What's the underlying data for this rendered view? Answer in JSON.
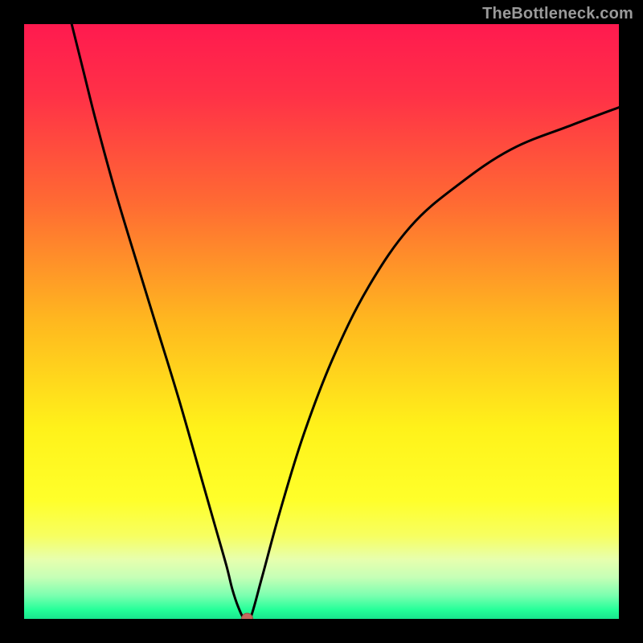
{
  "watermark": "TheBottleneck.com",
  "colors": {
    "frame": "#000000",
    "curve": "#000000",
    "marker_fill": "#c36a5e",
    "marker_stroke": "#9d4c42",
    "gradient_stops": [
      {
        "offset": 0.0,
        "color": "#ff1a4f"
      },
      {
        "offset": 0.12,
        "color": "#ff3147"
      },
      {
        "offset": 0.3,
        "color": "#ff6a33"
      },
      {
        "offset": 0.5,
        "color": "#ffb81f"
      },
      {
        "offset": 0.68,
        "color": "#fff21a"
      },
      {
        "offset": 0.8,
        "color": "#ffff2a"
      },
      {
        "offset": 0.86,
        "color": "#f7ff60"
      },
      {
        "offset": 0.9,
        "color": "#e7ffae"
      },
      {
        "offset": 0.93,
        "color": "#c6ffb6"
      },
      {
        "offset": 0.96,
        "color": "#7dffb0"
      },
      {
        "offset": 0.985,
        "color": "#24ff99"
      },
      {
        "offset": 1.0,
        "color": "#18e58e"
      }
    ]
  },
  "chart_data": {
    "type": "line",
    "title": "",
    "xlabel": "",
    "ylabel": "",
    "xlim": [
      0,
      100
    ],
    "ylim": [
      0,
      100
    ],
    "grid": false,
    "legend": false,
    "series": [
      {
        "name": "bottleneck-curve",
        "x": [
          8,
          10,
          12,
          15,
          18,
          22,
          26,
          30,
          32,
          34,
          35,
          36,
          37,
          38,
          40,
          43,
          47,
          52,
          58,
          65,
          73,
          82,
          92,
          100
        ],
        "y": [
          100,
          92,
          84,
          73,
          63,
          50,
          37,
          23,
          16,
          9,
          5,
          2,
          0,
          0,
          7,
          18,
          31,
          44,
          56,
          66,
          73,
          79,
          83,
          86
        ]
      }
    ],
    "annotations": [
      {
        "type": "marker",
        "x": 37.5,
        "y": 0,
        "label": "optimal-point"
      }
    ]
  }
}
